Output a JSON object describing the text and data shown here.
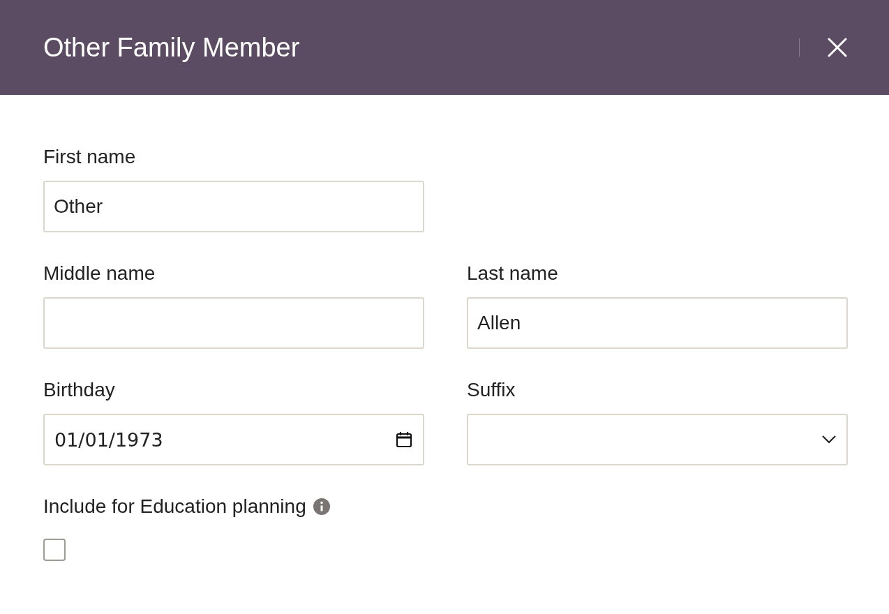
{
  "dialog": {
    "title": "Other Family Member"
  },
  "rows": [
    [
      {
        "kind": "text",
        "label": "First name",
        "value": "Other"
      }
    ],
    [
      {
        "kind": "text",
        "label": "Middle name"
      },
      {
        "kind": "text",
        "label": "Last name",
        "value": "Allen"
      }
    ],
    [
      {
        "kind": "date",
        "label": "Birthday",
        "value": "01/01/1973"
      },
      {
        "kind": "select",
        "label": "Suffix"
      }
    ]
  ],
  "checkbox": {
    "label": "Include for Education planning",
    "checked": false
  }
}
